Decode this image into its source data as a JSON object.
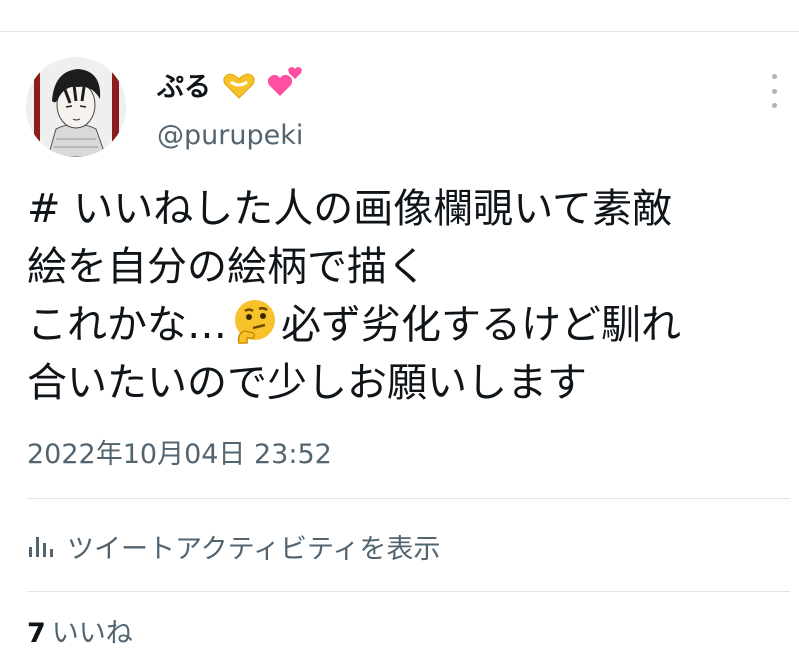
{
  "tweet": {
    "author": {
      "display_name": "ぷる",
      "handle": "@purupeki",
      "name_emojis": [
        "heart-hands-emoji",
        "two-hearts-emoji"
      ]
    },
    "text_line1": "# いいねした人の画像欄覗いて素敵",
    "text_line2": "絵を自分の絵柄で描く",
    "text_line3a": "これかな…",
    "text_line3b": "必ず劣化するけど馴れ",
    "text_line4": "合いたいので少しお願いします",
    "inline_emoji": "thinking-face-emoji",
    "timestamp": "2022年10月04日 23:52",
    "activity_label": "ツイートアクティビティを表示",
    "likes_count": "7",
    "likes_label": "いいね"
  },
  "colors": {
    "text": "#0f1419",
    "secondary": "#536471",
    "divider": "#e3e3e3",
    "emoji_yellow": "#f8c22b",
    "heart_pink": "#ff4fa0"
  }
}
